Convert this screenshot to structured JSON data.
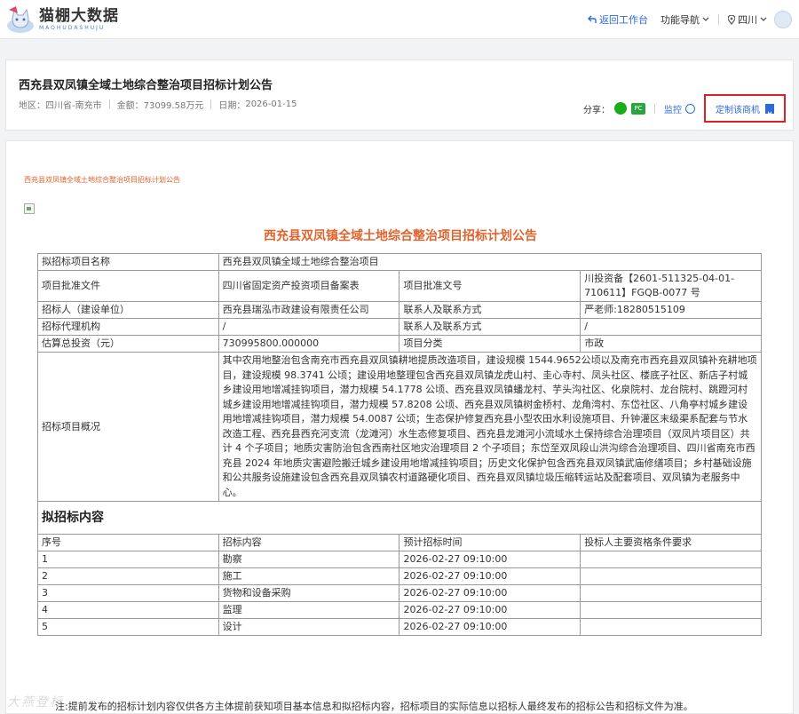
{
  "brand": {
    "name": "猫棚大数据",
    "sub": "MAOHUDASHUJU"
  },
  "nav": {
    "back": "返回工作台",
    "menu": "功能导航",
    "region": "四川"
  },
  "header": {
    "title": "西充县双凤镇全域土地综合整治项目招标计划公告",
    "region_label": "地区：",
    "region_value": "四川省-南充市",
    "amount_label": "金额：",
    "amount_value": "73099.58万元",
    "date_label": "日期：",
    "date_value": "2026-01-15",
    "share_label": "分享：",
    "pc_icon_text": "PC",
    "monitor_label": "监控",
    "custom_label": "定制该商机"
  },
  "content": {
    "small_title": "西充县双凤镇全域土地综合整治项目招标计划公告",
    "doc_title": "西充县双凤镇全域土地综合整治项目招标计划公告",
    "rows": {
      "name_label": "拟招标项目名称",
      "name_value": "西充县双凤镇全域土地综合整治项目",
      "approval_doc_label": "项目批准文件",
      "approval_doc_value": "四川省固定资产投资项目备案表",
      "approval_no_label": "项目批准文号",
      "approval_no_value": "川投资备【2601-511325-04-01-710611】FGQB-0077 号",
      "tenderer_label": "招标人（建设单位）",
      "tenderer_value": "西充县瑞泓市政建设有限责任公司",
      "contact_label": "联系人及联系方式",
      "contact_value": "严老师:18280515109",
      "agency_label": "招标代理机构",
      "agency_value": "/",
      "contact2_label": "联系人及联系方式",
      "contact2_value": "/",
      "invest_label": "估算总投资（元）",
      "invest_value": "730995800.000000",
      "category_label": "项目分类",
      "category_value": "市政",
      "overview_label": "招标项目概况",
      "overview_value": "其中农用地整治包含南充市西充县双凤镇耕地提质改造项目，建设规模 1544.9652公顷以及南充市西充县双凤镇补充耕地项目，建设规模 98.3741 公顷；建设用地整理包含西充县双凤镇龙虎山村、圭心寺村、凤头社区、楼底子社区、新店子村城乡建设用地增减挂钩项目，潜力规模 54.1778 公顷、西充县双凤镇蟠龙村、芋头沟社区、化泉院村、龙台院村、跳蹬河村城乡建设用地增减挂钩项目，潜力规模 57.8208 公顷、西充县双凤镇树金桥村、龙角湾村、东岱社区、八角亭村城乡建设用地增减挂钩项目，潜力规模 54.0087 公顷；生态保护修复西充县小型农田水利设施项目、升钟灌区末级渠系配套与节水改造工程、西充县西充河支流（龙滩河）水生态修复项目、西充县龙滩河小流域水土保持综合治理项目（双凤片项目区）共计 4 个子项目；地质灾害防治包含西南社区地灾治理项目 2 个子项目；东岱至双凤段山洪沟综合治理项目、四川省南充市西充县 2024 年地质灾害避险搬迁城乡建设用地增减挂钩项目；历史文化保护包含西充县双凤镇武庙修缮项目；乡村基础设施和公共服务设施建设包含西充县双凤镇农村道路硬化项目、西充县双凤镇垃圾压缩转运站及配套项目、双凤镇为老服务中心。"
    },
    "section_title": "拟招标内容",
    "list_headers": [
      "序号",
      "招标内容",
      "预计招标时间",
      "投标人主要资格条件要求"
    ],
    "list_rows": [
      {
        "no": "1",
        "content": "勘察",
        "time": "2026-02-27 09:10:00",
        "req": ""
      },
      {
        "no": "2",
        "content": "施工",
        "time": "2026-02-27 09:10:00",
        "req": ""
      },
      {
        "no": "3",
        "content": "货物和设备采购",
        "time": "2026-02-27 09:10:00",
        "req": ""
      },
      {
        "no": "4",
        "content": "监理",
        "time": "2026-02-27 09:10:00",
        "req": ""
      },
      {
        "no": "5",
        "content": "设计",
        "time": "2026-02-27 09:10:00",
        "req": ""
      }
    ],
    "footer_note": "注:提前发布的招标计划内容仅供各方主体提前获知项目基本信息和拟招标内容，招标项目的实际信息以招标人最终发布的招标公告和招标文件为准。"
  },
  "watermark": "大燕登标",
  "colors": {
    "accent_blue": "#2f6bd8",
    "accent_orange": "#e0632c",
    "highlight_red": "#e02020"
  }
}
